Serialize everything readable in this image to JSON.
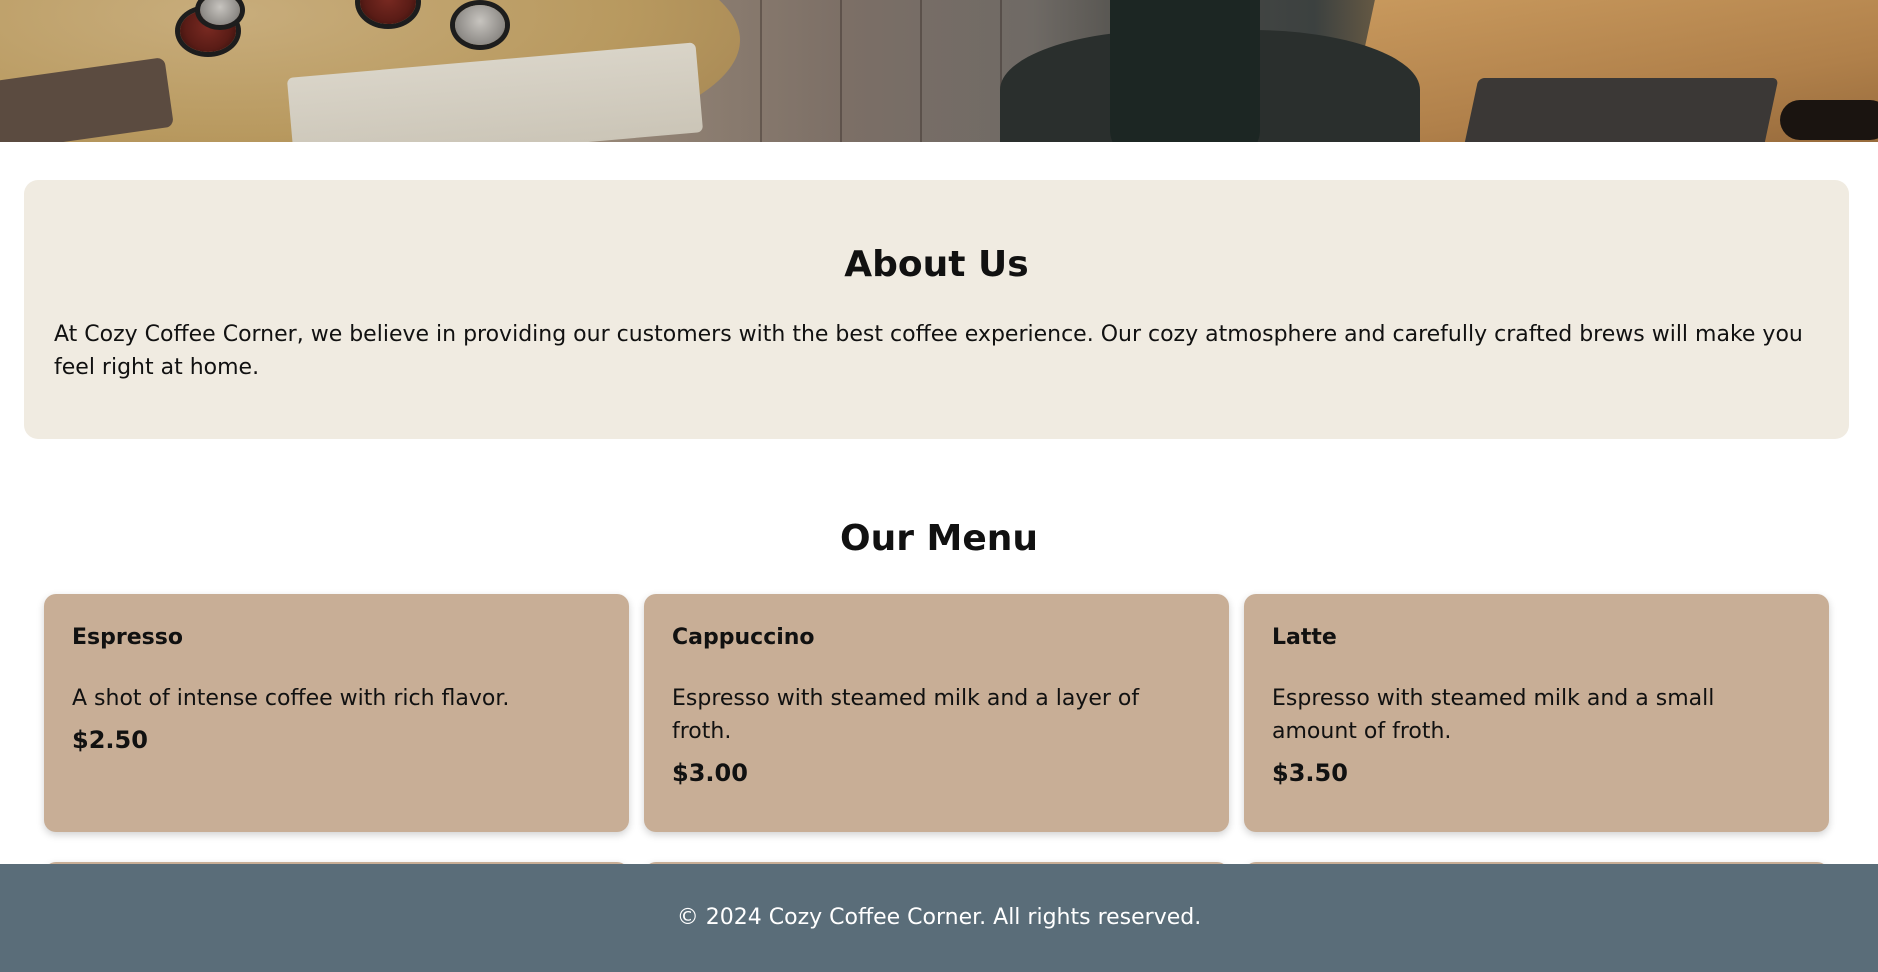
{
  "about": {
    "heading": "About Us",
    "text": "At Cozy Coffee Corner, we believe in providing our customers with the best coffee experience. Our cozy atmosphere and carefully crafted brews will make you feel right at home."
  },
  "menu": {
    "heading": "Our Menu",
    "items": [
      {
        "name": "Espresso",
        "description": "A shot of intense coffee with rich flavor.",
        "price": "$2.50"
      },
      {
        "name": "Cappuccino",
        "description": "Espresso with steamed milk and a layer of froth.",
        "price": "$3.00"
      },
      {
        "name": "Latte",
        "description": "Espresso with steamed milk and a small amount of froth.",
        "price": "$3.50"
      }
    ]
  },
  "footer": {
    "text": "© 2024 Cozy Coffee Corner. All rights reserved."
  },
  "colors": {
    "about_bg": "#f0ebe1",
    "card_bg": "#c8ae96",
    "footer_bg": "#5a6d79"
  }
}
